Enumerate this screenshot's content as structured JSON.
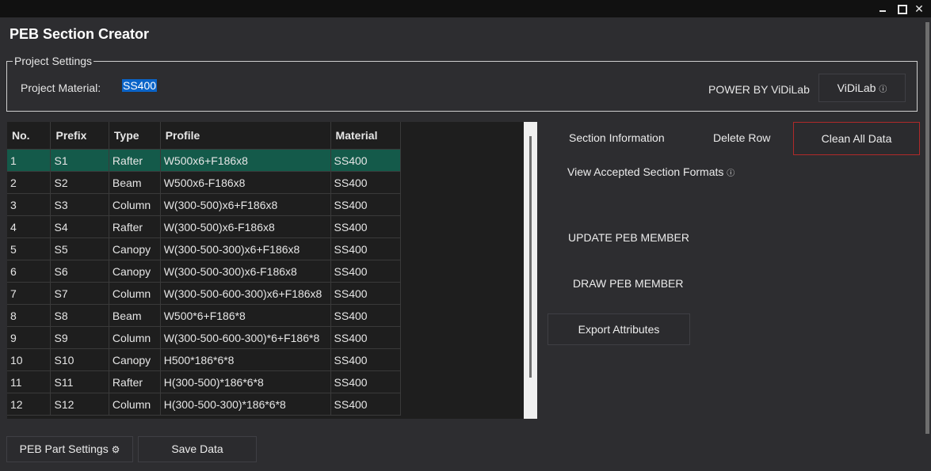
{
  "window": {
    "title": "PEB Section Creator",
    "minimize_icon": "minimize-icon",
    "maximize_icon": "maximize-icon",
    "close_icon": "close-icon",
    "close_glyph": "✕"
  },
  "project_settings": {
    "legend": "Project Settings",
    "material_label": "Project Material:",
    "material_value": "SS400",
    "power_text": "POWER BY ViDiLab",
    "vidilab_button": "ViDiLab",
    "info_glyph": "ⓘ"
  },
  "table": {
    "columns": [
      "No.",
      "Prefix",
      "Type",
      "Profile",
      "Material"
    ],
    "selected_row": 0,
    "rows": [
      [
        "1",
        "S1",
        "Rafter",
        "W500x6+F186x8",
        "SS400"
      ],
      [
        "2",
        "S2",
        "Beam",
        "W500x6-F186x8",
        "SS400"
      ],
      [
        "3",
        "S3",
        "Column",
        "W(300-500)x6+F186x8",
        "SS400"
      ],
      [
        "4",
        "S4",
        "Rafter",
        "W(300-500)x6-F186x8",
        "SS400"
      ],
      [
        "5",
        "S5",
        "Canopy",
        "W(300-500-300)x6+F186x8",
        "SS400"
      ],
      [
        "6",
        "S6",
        "Canopy",
        "W(300-500-300)x6-F186x8",
        "SS400"
      ],
      [
        "7",
        "S7",
        "Column",
        "W(300-500-600-300)x6+F186x8",
        "SS400"
      ],
      [
        "8",
        "S8",
        "Beam",
        "W500*6+F186*8",
        "SS400"
      ],
      [
        "9",
        "S9",
        "Column",
        "W(300-500-600-300)*6+F186*8",
        "SS400"
      ],
      [
        "10",
        "S10",
        "Canopy",
        "H500*186*6*8",
        "SS400"
      ],
      [
        "11",
        "S11",
        "Rafter",
        "H(300-500)*186*6*8",
        "SS400"
      ],
      [
        "12",
        "S12",
        "Column",
        "H(300-500-300)*186*6*8",
        "SS400"
      ]
    ]
  },
  "actions": {
    "section_information": "Section Information",
    "delete_row": "Delete Row",
    "clean_all_data": "Clean All Data",
    "view_formats": "View Accepted Section Formats",
    "update_member": "UPDATE PEB MEMBER",
    "draw_member": "DRAW PEB MEMBER",
    "export_attributes": "Export Attributes",
    "peb_part_settings": "PEB Part Settings",
    "gear_glyph": "⚙",
    "save_data": "Save Data"
  },
  "colors": {
    "background": "#2d2d30",
    "selected_row": "#145a4a",
    "highlight": "#0a64c8",
    "danger_border": "#b02a2a"
  }
}
